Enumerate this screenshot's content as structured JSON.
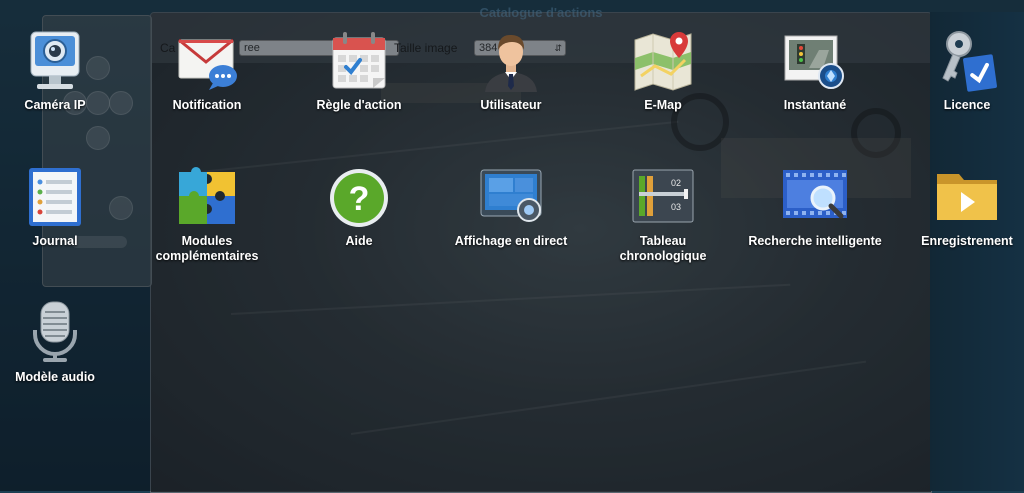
{
  "background_window": {
    "title": "Catalogue d'actions",
    "field_1_label": "Ca",
    "field_1_value": "ree",
    "field_2_label": "Taille image",
    "field_2_value": "384  0"
  },
  "apps": [
    {
      "id": "camera",
      "label": "Caméra IP",
      "icon": "ip-camera-icon"
    },
    {
      "id": "notification",
      "label": "Notification",
      "icon": "envelope-chat-icon"
    },
    {
      "id": "action-rule",
      "label": "Règle d'action",
      "icon": "calendar-check-icon"
    },
    {
      "id": "user",
      "label": "Utilisateur",
      "icon": "user-person-icon"
    },
    {
      "id": "emap",
      "label": "E-Map",
      "icon": "map-pin-icon"
    },
    {
      "id": "snapshot",
      "label": "Instantané",
      "icon": "snapshot-photos-icon"
    },
    {
      "id": "license",
      "label": "Licence",
      "icon": "key-license-icon"
    },
    {
      "id": "log",
      "label": "Journal",
      "icon": "clipboard-list-icon"
    },
    {
      "id": "addons",
      "label_line1": "Modules",
      "label_line2": "complémentaires",
      "icon": "puzzle-icon"
    },
    {
      "id": "help",
      "label": "Aide",
      "icon": "question-mark-icon"
    },
    {
      "id": "live-view",
      "label": "Affichage en direct",
      "icon": "live-view-monitor-icon"
    },
    {
      "id": "timeline",
      "label_line1": "Tableau",
      "label_line2": "chronologique",
      "icon": "timeline-icon"
    },
    {
      "id": "smart-search",
      "label": "Recherche intelligente",
      "icon": "filmstrip-magnifier-icon"
    },
    {
      "id": "recording",
      "label": "Enregistrement",
      "icon": "folder-play-icon"
    },
    {
      "id": "audio",
      "label": "Modèle audio",
      "icon": "microphone-icon"
    }
  ],
  "colors": {
    "desktop_bg": "#1d3f52",
    "label_text": "#ffffff",
    "accent_blue": "#2f7fd0",
    "help_green": "#5aa82a",
    "map_red": "#d83a3a"
  }
}
